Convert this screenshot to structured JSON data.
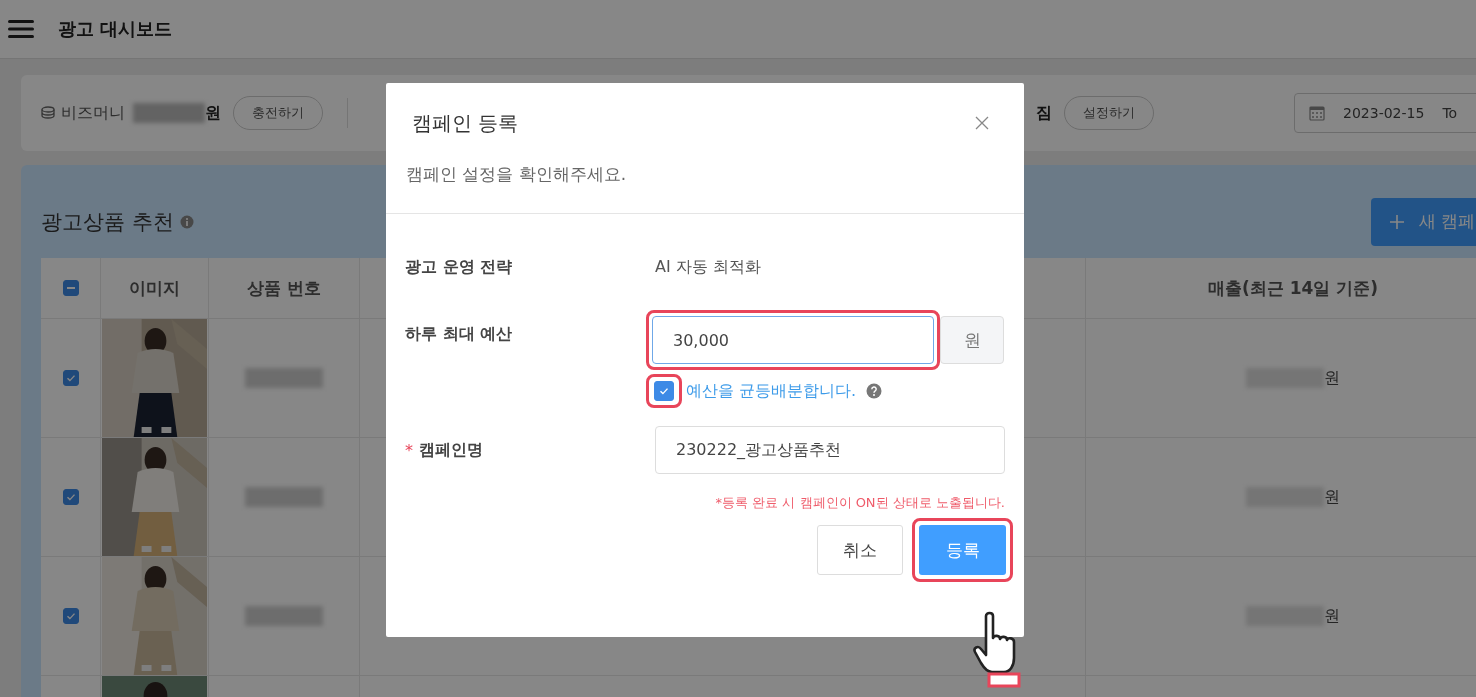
{
  "header": {
    "title": "광고 대시보드"
  },
  "bizmoney": {
    "label": "비즈머니",
    "unit": "원",
    "charge_button": "충전하기"
  },
  "auto_status": {
    "text": "짐",
    "button": "설정하기"
  },
  "date_range": {
    "start": "2023-02-15",
    "to": "To"
  },
  "panel": {
    "title": "광고상품 추천",
    "new_button": "새 캠페"
  },
  "table": {
    "select_all": {
      "indeterminate": true
    },
    "columns": [
      {
        "label": "이미지"
      },
      {
        "label": "상품 번호"
      },
      {
        "label": "매출(최근 14일 기준)"
      }
    ],
    "rows": [
      {
        "checked": true,
        "sales_unit": "원"
      },
      {
        "checked": true,
        "sales_unit": "원"
      },
      {
        "checked": true,
        "sales_unit": "원"
      }
    ]
  },
  "dialog": {
    "title": "캠페인 등록",
    "subtitle": "캠페인 설정을 확인해주세요.",
    "fields": [
      {
        "kind": "text",
        "label": "광고 운영 전략",
        "value": "AI 자동 최적화"
      },
      {
        "kind": "budget",
        "label": "하루 최대 예산",
        "value": "30,000",
        "unit": "원",
        "highlighted": true,
        "checkbox": {
          "label": "예산을 균등배분합니다.",
          "checked": true,
          "highlighted": true
        }
      },
      {
        "kind": "input",
        "label": "캠페인명",
        "required_mark": "*",
        "value": "230222_광고상품추천"
      }
    ],
    "note": "*등록 완료 시 캠페인이 ON된 상태로 노출됩니다.",
    "buttons": [
      {
        "label": "취소",
        "kind": "secondary",
        "highlighted": false
      },
      {
        "label": "등록",
        "kind": "primary",
        "highlighted": true
      }
    ]
  }
}
